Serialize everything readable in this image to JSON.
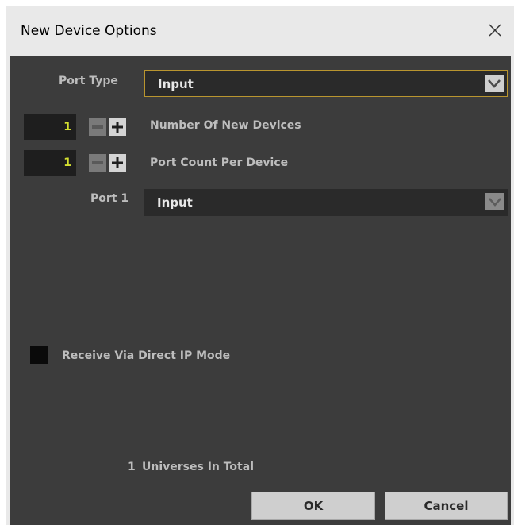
{
  "window": {
    "title": "New Device Options"
  },
  "port_type": {
    "label": "Port Type",
    "value": "Input"
  },
  "num_devices": {
    "label": "Number Of New Devices",
    "value": "1"
  },
  "port_count": {
    "label": "Port Count Per Device",
    "value": "1"
  },
  "port1": {
    "label": "Port 1",
    "value": "Input"
  },
  "direct_ip": {
    "label": "Receive Via Direct IP Mode",
    "checked": false
  },
  "universes": {
    "count": "1",
    "label": "Universes In Total"
  },
  "buttons": {
    "ok": "OK",
    "cancel": "Cancel"
  },
  "colors": {
    "panel_bg": "#3c3c3c",
    "accent_border": "#b9952f",
    "stepper_value": "#d4e030"
  },
  "icons": {
    "close": "close-icon",
    "dropdown": "chevron-down-icon",
    "minus": "minus-icon",
    "plus": "plus-icon"
  }
}
